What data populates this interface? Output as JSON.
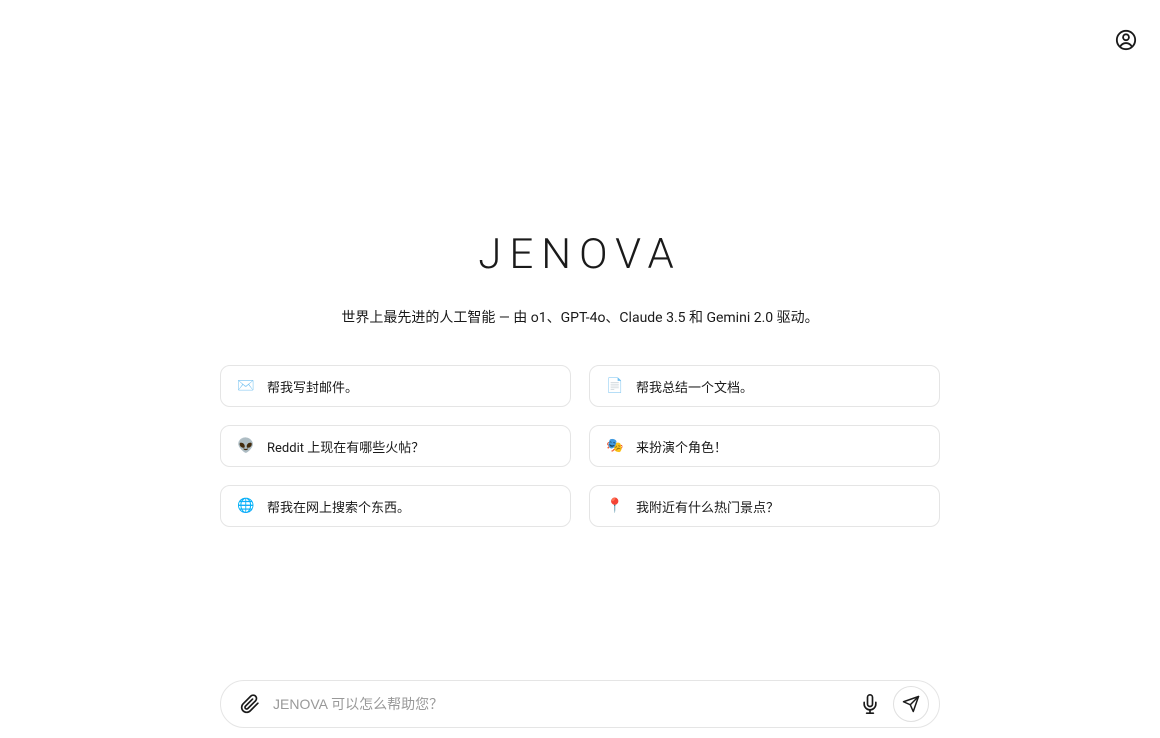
{
  "header": {
    "logo": "JENOVA",
    "tagline": "世界上最先进的人工智能 — 由 o1、GPT-4o、Claude 3.5 和 Gemini 2.0 驱动。"
  },
  "suggestions": [
    {
      "icon": "✉️",
      "label": "帮我写封邮件。"
    },
    {
      "icon": "📄",
      "label": "帮我总结一个文档。"
    },
    {
      "icon": "👽",
      "label": "Reddit 上现在有哪些火帖？"
    },
    {
      "icon": "🎭",
      "label": "来扮演个角色！"
    },
    {
      "icon": "🌐",
      "label": "帮我在网上搜索个东西。"
    },
    {
      "icon": "📍",
      "label": "我附近有什么热门景点？"
    }
  ],
  "input": {
    "placeholder": "JENOVA 可以怎么帮助您？"
  }
}
